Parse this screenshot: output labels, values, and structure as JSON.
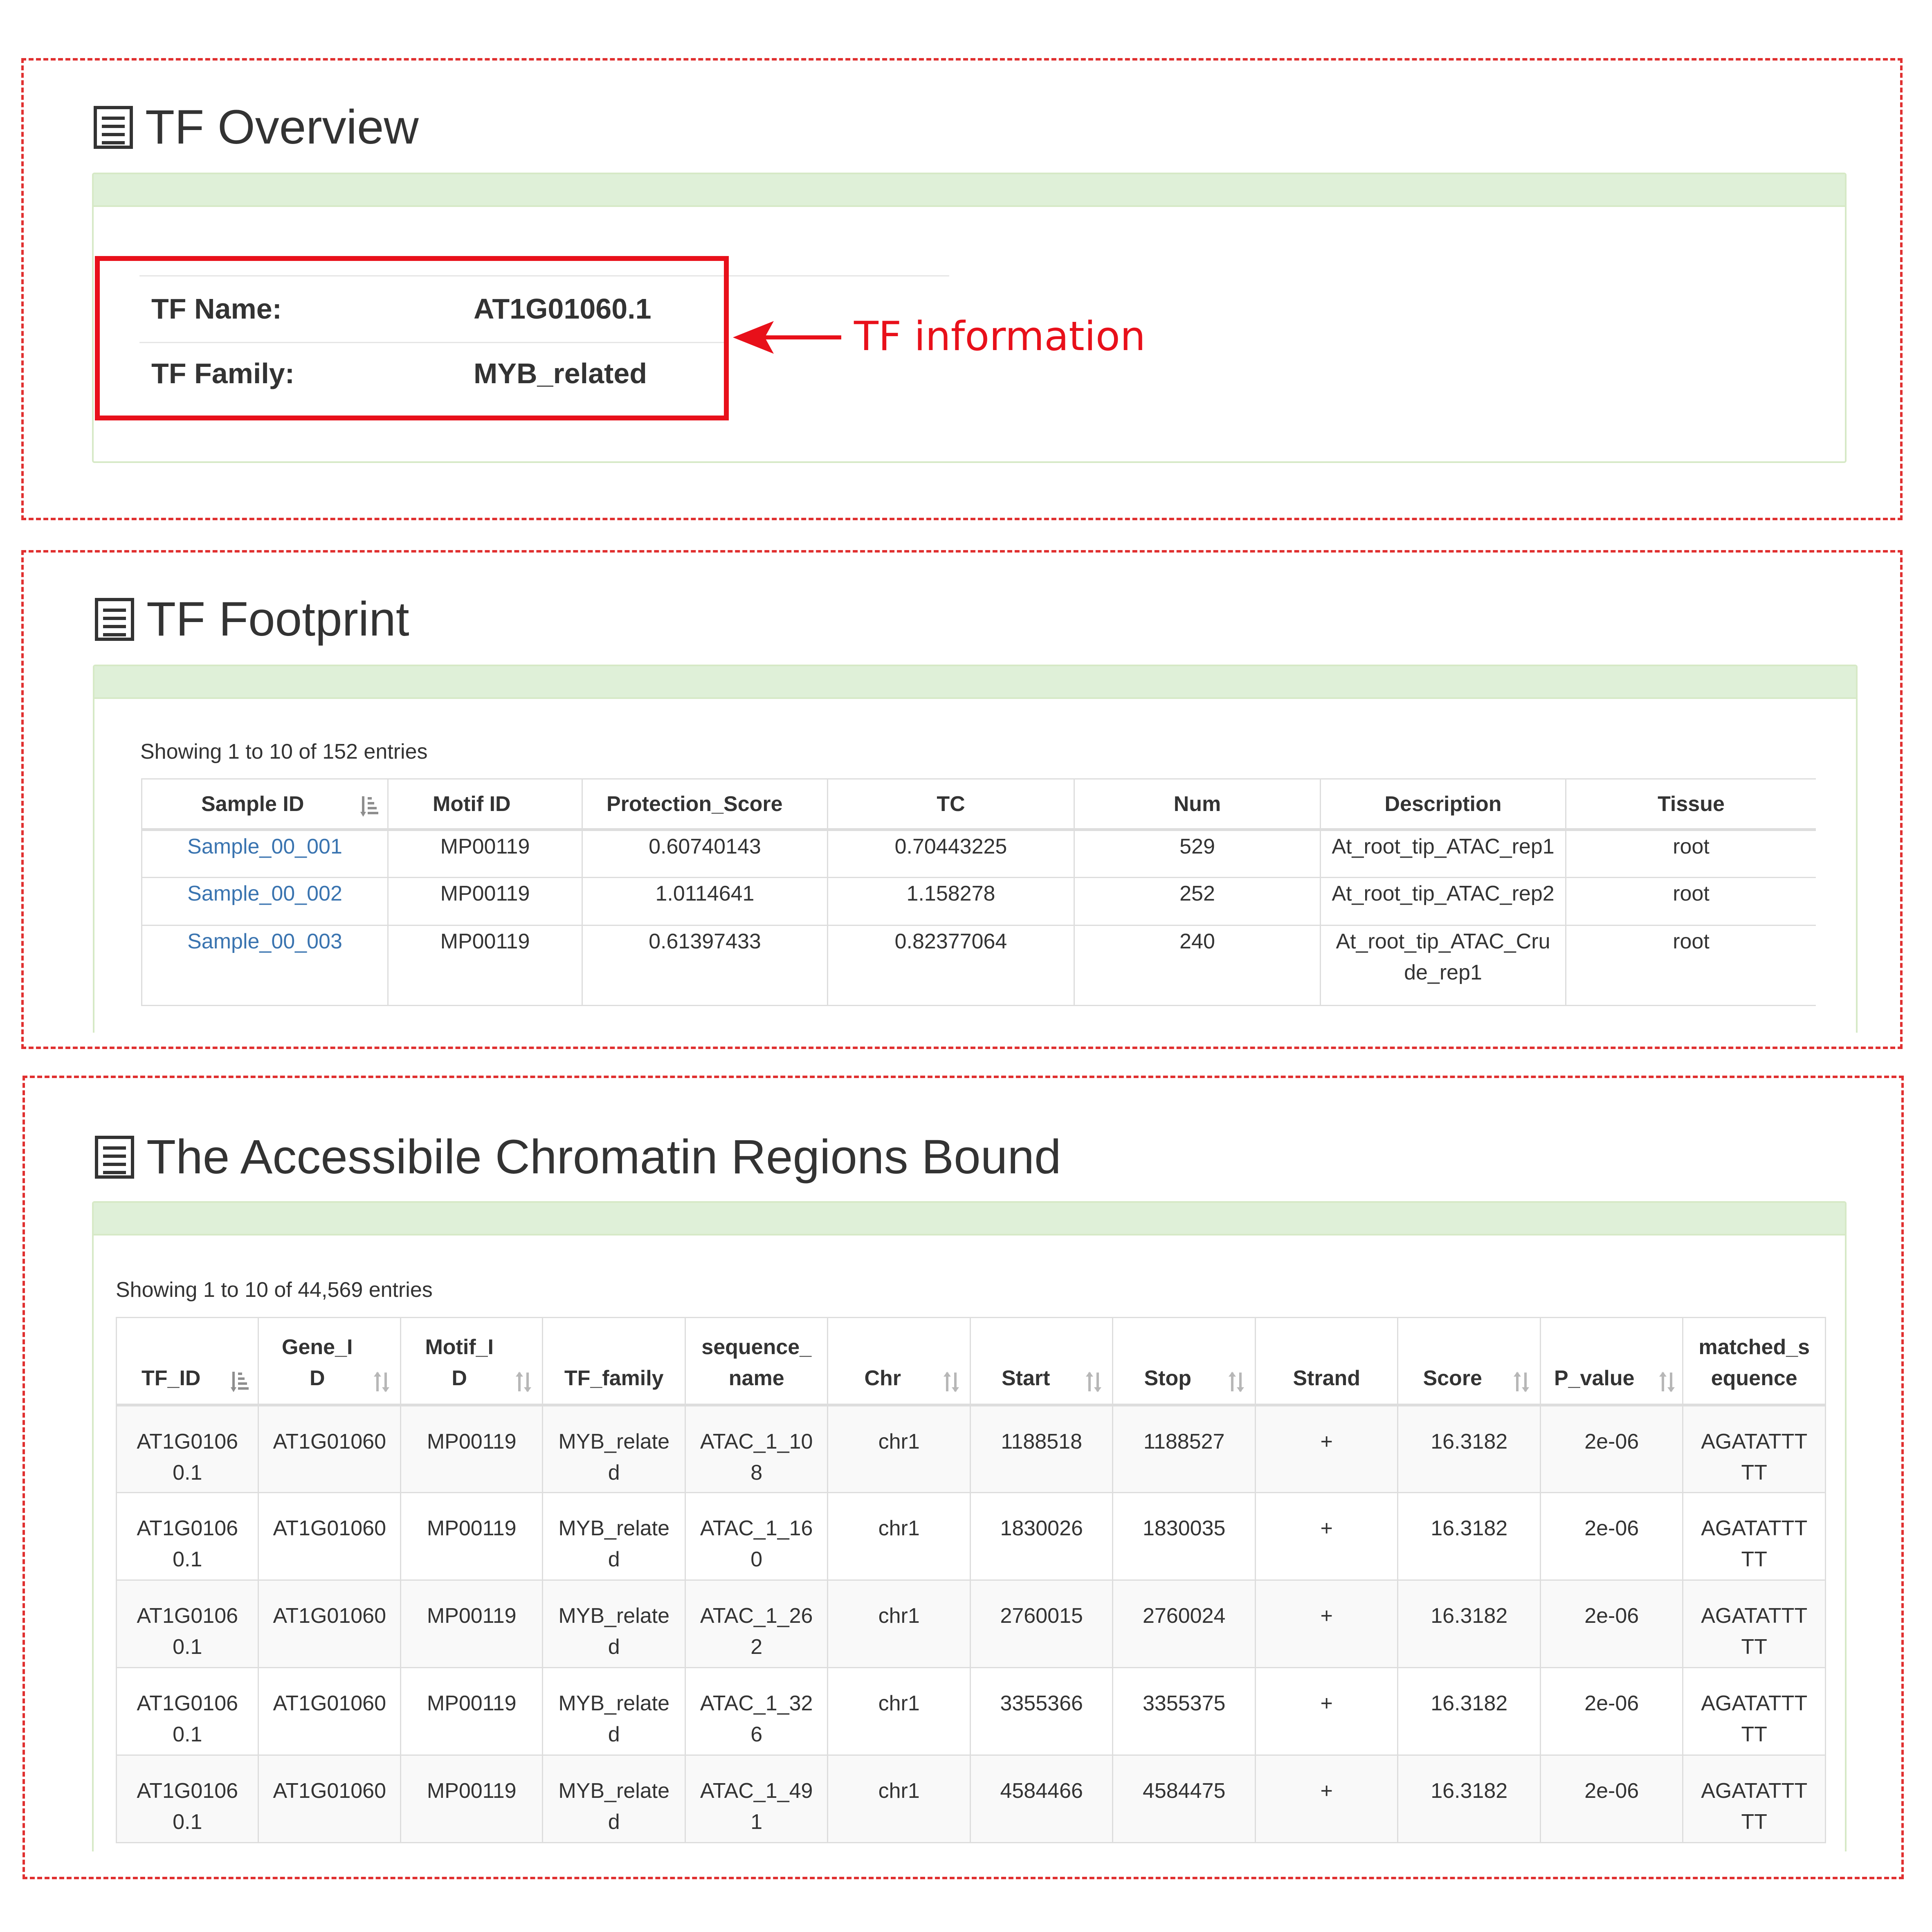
{
  "overview": {
    "title": "TF Overview",
    "name_label": "TF Name:",
    "name_value": "AT1G01060.1",
    "family_label": "TF Family:",
    "family_value": "MYB_related",
    "annotation": "TF information"
  },
  "footprint": {
    "title": "TF Footprint",
    "showing": "Showing 1 to 10 of 152 entries",
    "columns": [
      "Sample ID",
      "Motif ID",
      "Protection_Score",
      "TC",
      "Num",
      "Description",
      "Tissue"
    ],
    "rows": [
      [
        "Sample_00_001",
        "MP00119",
        "0.60740143",
        "0.70443225",
        "529",
        "At_root_tip_ATAC_rep1",
        "root"
      ],
      [
        "Sample_00_002",
        "MP00119",
        "1.0114641",
        "1.158278",
        "252",
        "At_root_tip_ATAC_rep2",
        "root"
      ],
      [
        "Sample_00_003",
        "MP00119",
        "0.61397433",
        "0.82377064",
        "240",
        "At_root_tip_ATAC_Crude_rep1",
        "root"
      ]
    ]
  },
  "regions": {
    "title": "The Accessibile Chromatin Regions Bound",
    "showing": "Showing 1 to 10 of 44,569 entries",
    "columns": [
      "TF_ID",
      "Gene_ID",
      "Motif_ID",
      "TF_family",
      "sequence_name",
      "Chr",
      "Start",
      "Stop",
      "Strand",
      "Score",
      "P_value",
      "matched_sequence"
    ],
    "rows": [
      [
        "AT1G01060.1",
        "AT1G01060",
        "MP00119",
        "MYB_related",
        "ATAC_1_108",
        "chr1",
        "1188518",
        "1188527",
        "+",
        "16.3182",
        "2e-06",
        "AGATATTTTT"
      ],
      [
        "AT1G01060.1",
        "AT1G01060",
        "MP00119",
        "MYB_related",
        "ATAC_1_160",
        "chr1",
        "1830026",
        "1830035",
        "+",
        "16.3182",
        "2e-06",
        "AGATATTTTT"
      ],
      [
        "AT1G01060.1",
        "AT1G01060",
        "MP00119",
        "MYB_related",
        "ATAC_1_262",
        "chr1",
        "2760015",
        "2760024",
        "+",
        "16.3182",
        "2e-06",
        "AGATATTTTT"
      ],
      [
        "AT1G01060.1",
        "AT1G01060",
        "MP00119",
        "MYB_related",
        "ATAC_1_326",
        "chr1",
        "3355366",
        "3355375",
        "+",
        "16.3182",
        "2e-06",
        "AGATATTTTT"
      ],
      [
        "AT1G01060.1",
        "AT1G01060",
        "MP00119",
        "MYB_related",
        "ATAC_1_491",
        "chr1",
        "4584466",
        "4584475",
        "+",
        "16.3182",
        "2e-06",
        "AGATATTTTT"
      ]
    ]
  }
}
